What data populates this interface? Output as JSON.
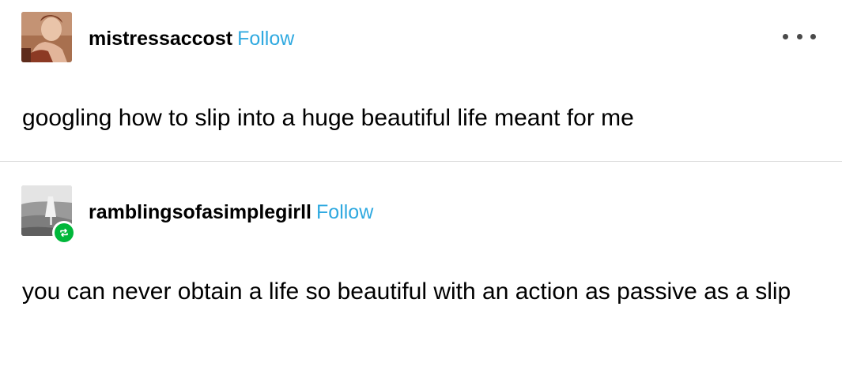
{
  "posts": [
    {
      "username": "mistressaccost",
      "follow_label": "Follow",
      "body": "googling how to slip into a huge beautiful life meant for me",
      "avatar_icon": "portrait-photo",
      "menu_icon": "more-horizontal-icon"
    },
    {
      "username": "ramblingsofasimplegirll",
      "follow_label": "Follow",
      "body": "you can never obtain a life so beautiful with an action as passive as a slip",
      "avatar_icon": "grayscale-photo",
      "badge_icon": "reblog-icon"
    }
  ],
  "colors": {
    "follow": "#2fa9e0",
    "reblog_badge": "#00b73a",
    "divider": "#d9d9d9"
  }
}
